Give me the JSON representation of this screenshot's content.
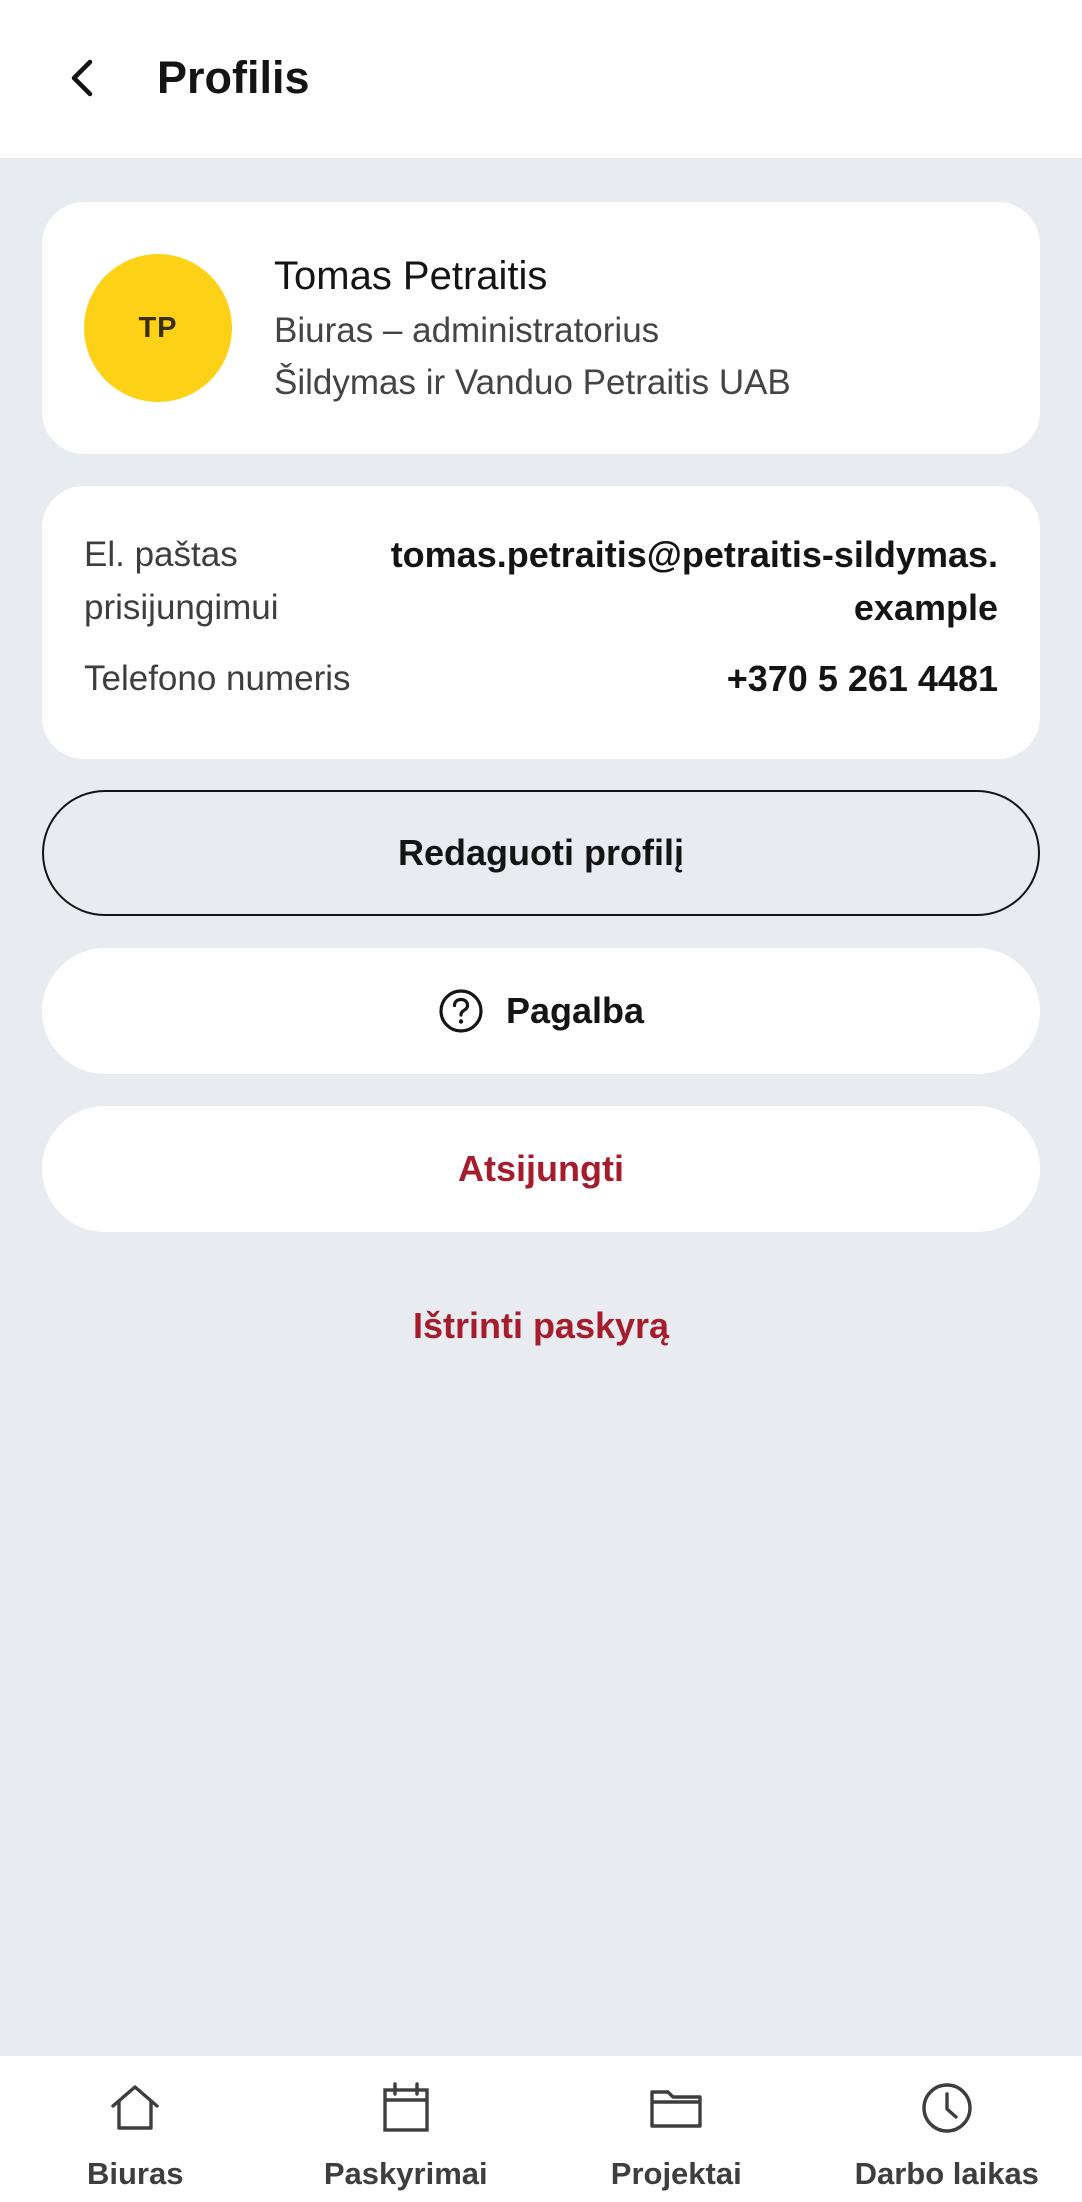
{
  "header": {
    "title": "Profilis",
    "back_icon": "chevron-left-icon"
  },
  "profile": {
    "initials": "TP",
    "name": "Tomas Petraitis",
    "role": "Biuras – administratorius",
    "company": "Šildymas ir Vanduo Petraitis UAB",
    "avatar_color": "#fcd116"
  },
  "info": {
    "email_label": "El. paštas prisijungimui",
    "email_value": "tomas.petraitis@petraitis-sildymas.example",
    "phone_label": "Telefono numeris",
    "phone_value": "+370 5 261 4481"
  },
  "actions": {
    "edit_label": "Redaguoti profilį",
    "help_label": "Pagalba",
    "help_icon": "question-circle-icon",
    "logout_label": "Atsijungti",
    "delete_label": "Ištrinti paskyrą",
    "danger_color": "#a51d2d"
  },
  "bottom_nav": {
    "items": [
      {
        "label": "Biuras",
        "icon": "home-icon"
      },
      {
        "label": "Paskyrimai",
        "icon": "calendar-icon"
      },
      {
        "label": "Projektai",
        "icon": "folder-icon"
      },
      {
        "label": "Darbo laikas",
        "icon": "clock-icon"
      }
    ]
  }
}
